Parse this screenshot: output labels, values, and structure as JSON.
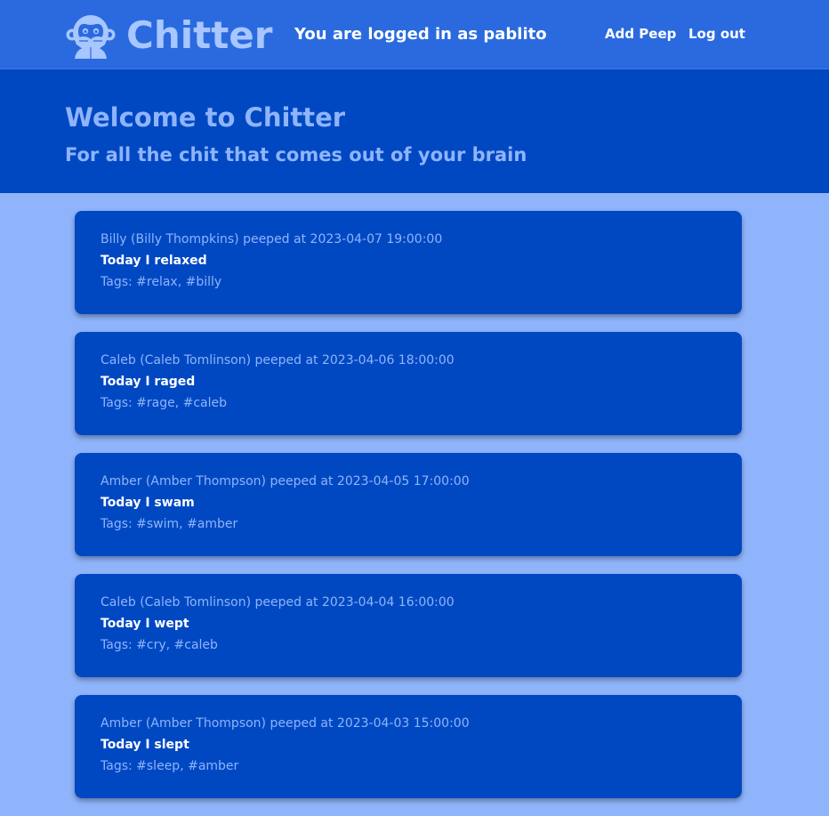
{
  "navbar": {
    "brand_name": "Chitter",
    "logo_icon": "monkey-icon",
    "logged_in_text": "You are logged in as pablito",
    "add_peep_label": "Add Peep",
    "log_out_label": "Log out"
  },
  "hero": {
    "title": "Welcome to Chitter",
    "subtitle": "For all the chit that comes out of your brain"
  },
  "peeps": [
    {
      "meta": "Billy (Billy Thompkins) peeped at 2023-04-07 19:00:00",
      "content": "Today I relaxed",
      "tags": "Tags: #relax, #billy"
    },
    {
      "meta": "Caleb (Caleb Tomlinson) peeped at 2023-04-06 18:00:00",
      "content": "Today I raged",
      "tags": "Tags: #rage, #caleb"
    },
    {
      "meta": "Amber (Amber Thompson) peeped at 2023-04-05 17:00:00",
      "content": "Today I swam",
      "tags": "Tags: #swim, #amber"
    },
    {
      "meta": "Caleb (Caleb Tomlinson) peeped at 2023-04-04 16:00:00",
      "content": "Today I wept",
      "tags": "Tags: #cry, #caleb"
    },
    {
      "meta": "Amber (Amber Thompson) peeped at 2023-04-03 15:00:00",
      "content": "Today I slept",
      "tags": "Tags: #sleep, #amber"
    }
  ],
  "colors": {
    "navbar_bg": "#2a6ade",
    "hero_bg": "#0048c2",
    "page_bg": "#8fb4fb",
    "card_bg": "#0048c2",
    "accent_text": "#8fb4fb"
  }
}
